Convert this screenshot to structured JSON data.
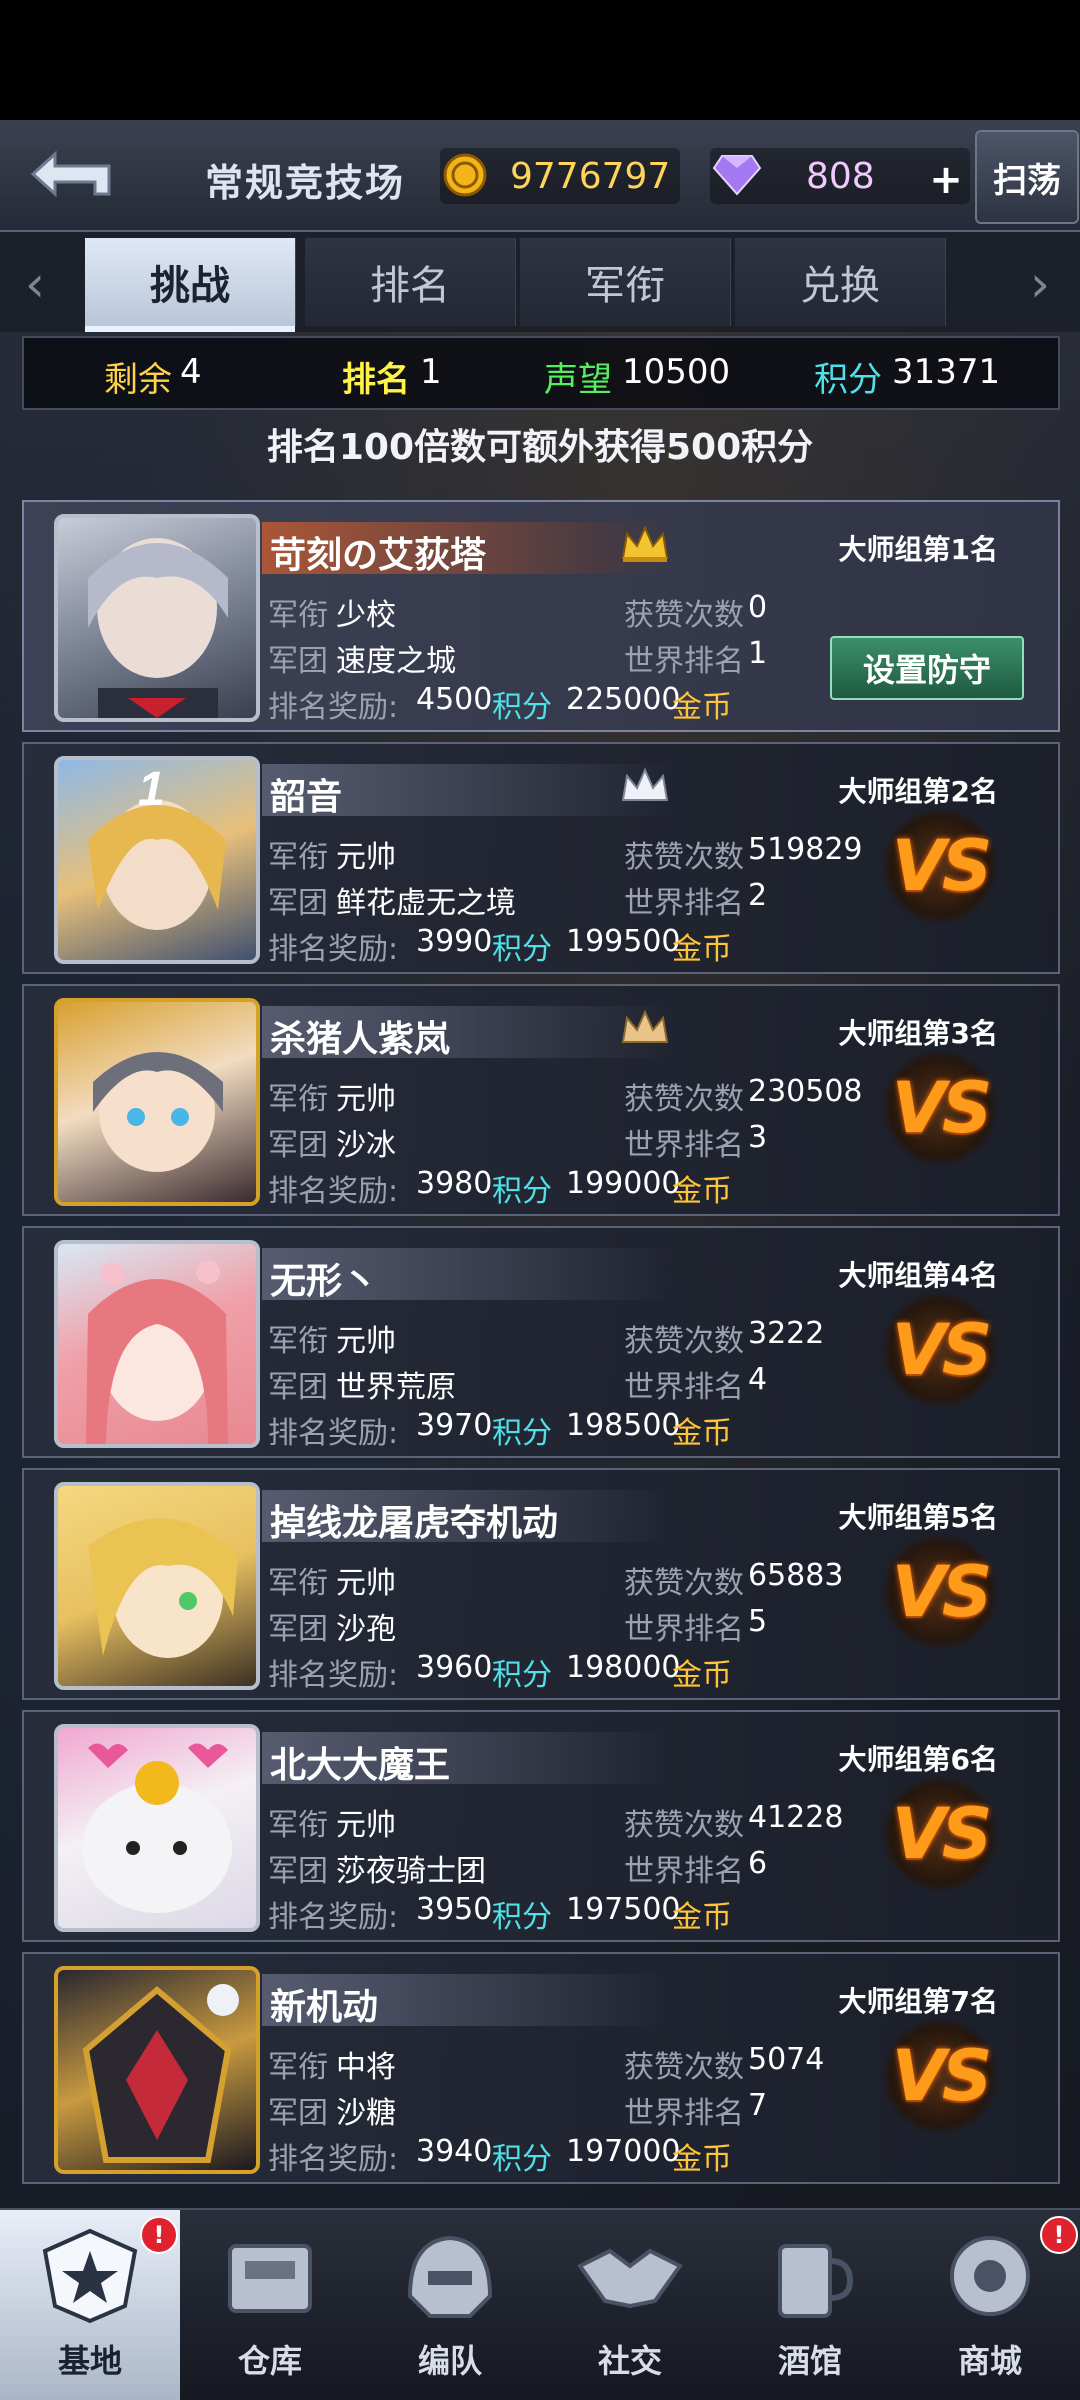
{
  "header": {
    "title": "常规竞技场",
    "gold": "9776797",
    "gems": "808",
    "plus_label": "+",
    "sweep_label": "扫荡"
  },
  "tabs": [
    {
      "label": "挑战",
      "active": true
    },
    {
      "label": "排名",
      "active": false
    },
    {
      "label": "军衔",
      "active": false
    },
    {
      "label": "兑换",
      "active": false
    }
  ],
  "stats": {
    "remaining_label": "剩余",
    "remaining": "4",
    "rank_label": "排名",
    "rank": "1",
    "prestige_label": "声望",
    "prestige": "10500",
    "points_label": "积分",
    "points": "31371"
  },
  "hint": "排名100倍数可额外获得500积分",
  "labels": {
    "rank_title": "军衔",
    "legion": "军团",
    "likes": "获赞次数",
    "world_rank": "世界排名",
    "reward": "排名奖励:",
    "points_unit": "积分",
    "gold_unit": "金币",
    "defend_button": "设置防守",
    "vs": "VS"
  },
  "players": [
    {
      "name": "苛刻の艾荻塔",
      "group_rank": "大师组第1名",
      "title": "少校",
      "legion": "速度之城",
      "likes": "0",
      "world_rank": "1",
      "reward_points": "4500",
      "reward_gold": "225000",
      "self": true
    },
    {
      "name": "韶音",
      "group_rank": "大师组第2名",
      "title": "元帅",
      "legion": "鲜花虚无之境",
      "likes": "519829",
      "world_rank": "2",
      "reward_points": "3990",
      "reward_gold": "199500"
    },
    {
      "name": "杀猪人紫岚",
      "group_rank": "大师组第3名",
      "title": "元帅",
      "legion": "沙冰",
      "likes": "230508",
      "world_rank": "3",
      "reward_points": "3980",
      "reward_gold": "199000"
    },
    {
      "name": "无形丶",
      "group_rank": "大师组第4名",
      "title": "元帅",
      "legion": "世界荒原",
      "likes": "3222",
      "world_rank": "4",
      "reward_points": "3970",
      "reward_gold": "198500"
    },
    {
      "name": "掉线龙屠虎夺机动",
      "group_rank": "大师组第5名",
      "title": "元帅",
      "legion": "沙孢",
      "likes": "65883",
      "world_rank": "5",
      "reward_points": "3960",
      "reward_gold": "198000"
    },
    {
      "name": "北大大魔王",
      "group_rank": "大师组第6名",
      "title": "元帅",
      "legion": "莎夜骑士团",
      "likes": "41228",
      "world_rank": "6",
      "reward_points": "3950",
      "reward_gold": "197500"
    },
    {
      "name": "新机动",
      "group_rank": "大师组第7名",
      "title": "中将",
      "legion": "沙糖",
      "likes": "5074",
      "world_rank": "7",
      "reward_points": "3940",
      "reward_gold": "197000"
    }
  ],
  "nav": [
    {
      "label": "基地",
      "active": true,
      "badge": "!"
    },
    {
      "label": "仓库"
    },
    {
      "label": "编队"
    },
    {
      "label": "社交"
    },
    {
      "label": "酒馆"
    },
    {
      "label": "商城",
      "badge": "!"
    }
  ],
  "colors": {
    "gold_text": "#ffd45a",
    "cyan_text": "#4fe0e8",
    "vs_orange": "#ff9b1a",
    "badge_red": "#e0222e"
  }
}
